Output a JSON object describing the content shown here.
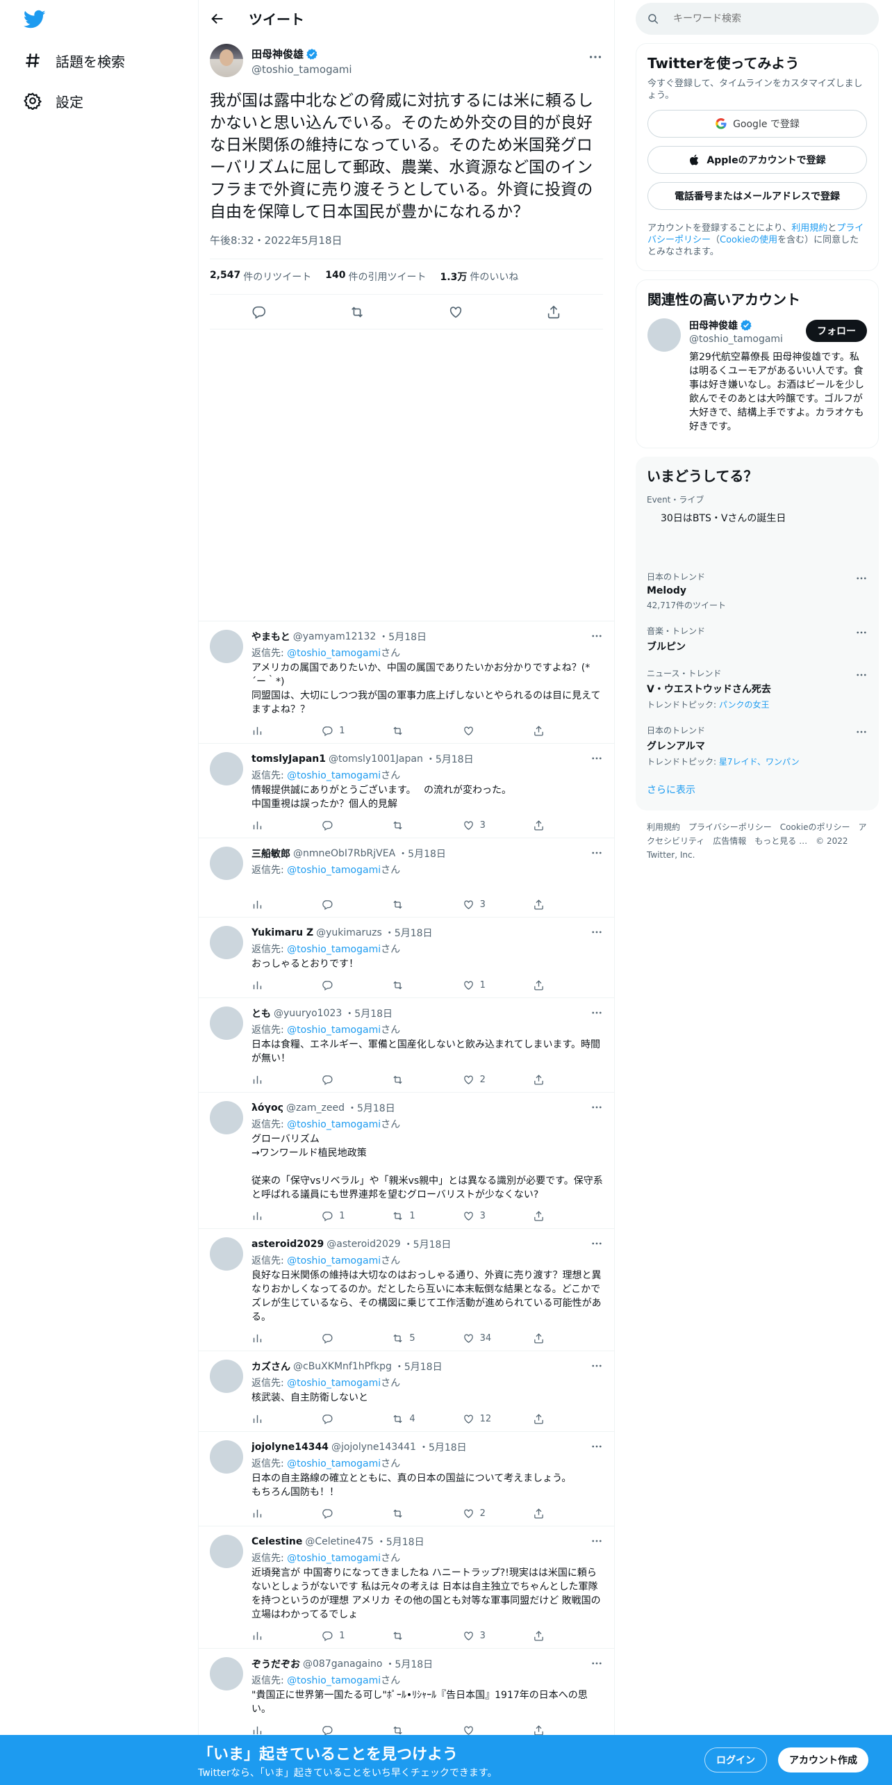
{
  "nav": {
    "explore": "話題を検索",
    "settings": "設定"
  },
  "header": {
    "title": "ツイート"
  },
  "tweet": {
    "author_name": "田母神俊雄",
    "author_handle": "@toshio_tamogami",
    "text": "我が国は露中北などの脅威に対抗するには米に頼るしかないと思い込んでいる。そのため外交の目的が良好な日米関係の維持になっている。そのため米国発グローバリズムに屈して郵政、農業、水資源など国のインフラまで外資に売り渡そうとしている。外資に投資の自由を保障して日本国民が豊かになれるか？",
    "time": "午後8:32・2022年5月18日",
    "retweets": "2,547",
    "retweets_label": "件のリツイート",
    "quotes": "140",
    "quotes_label": "件の引用ツイート",
    "likes": "1.3万",
    "likes_label": "件のいいね"
  },
  "reply_prefix": "返信先: ",
  "reply_suffix": "さん",
  "replies": [
    {
      "name": "やまもと",
      "handle": "@yamyam12132",
      "date": "・5月18日",
      "to": "@toshio_tamogami",
      "text": "アメリカの属国でありたいか、中国の属国でありたいかお分かりですよね？(*´ー｀*)\n同盟国は、大切にしつつ我が国の軍事力底上げしないとやられるのは目に見えてますよね？？",
      "replies": "1",
      "retweets": "",
      "likes": ""
    },
    {
      "name": "tomslyJapan1",
      "handle": "@tomsly1001Japan",
      "date": "・5月18日",
      "to": "@toshio_tamogami",
      "text": "情報提供誠にありがとうございます。　 の流れが変わった。\n中国重視は誤ったか？個人的見解",
      "replies": "",
      "retweets": "",
      "likes": "3"
    },
    {
      "name": "三船敏郎",
      "handle": "@nmneObI7RbRjVEA",
      "date": "・5月18日",
      "to": "@toshio_tamogami",
      "text": "",
      "replies": "",
      "retweets": "",
      "likes": "3"
    },
    {
      "name": "Yukimaru Z",
      "handle": "@yukimaruzs",
      "date": "・5月18日",
      "to": "@toshio_tamogami",
      "text": "おっしゃるとおりです！",
      "replies": "",
      "retweets": "",
      "likes": "1"
    },
    {
      "name": "とも",
      "handle": "@yuuryo1023",
      "date": "・5月18日",
      "to": "@toshio_tamogami",
      "text": "日本は食糧、エネルギー、軍備と国産化しないと飲み込まれてしまいます。時間が無い！",
      "replies": "",
      "retweets": "",
      "likes": "2"
    },
    {
      "name": "λόγος",
      "handle": "@zam_zeed",
      "date": "・5月18日",
      "to": "@toshio_tamogami",
      "text": "グローバリズム\n→ワンワールド植民地政策\n\n従来の「保守vsリベラル」や「親米vs親中」とは異なる識別が必要です。保守系と呼ばれる議員にも世界連邦を望むグローバリストが少なくない?",
      "replies": "1",
      "retweets": "1",
      "likes": "3"
    },
    {
      "name": "asteroid2029",
      "handle": "@asteroid2029",
      "date": "・5月18日",
      "to": "@toshio_tamogami",
      "text": "良好な日米関係の維持は大切なのはおっしゃる通り、外資に売り渡す？理想と異なりおかしくなってるのか。だとしたら互いに本末転倒な結果となる。どこかでズレが生じているなら、その構図に乗じて工作活動が進められている可能性がある。",
      "replies": "",
      "retweets": "5",
      "likes": "34"
    },
    {
      "name": "カズさん",
      "handle": "@cBuXKMnf1hPfkpg",
      "date": "・5月18日",
      "to": "@toshio_tamogami",
      "text": "核武装、自主防衛しないと",
      "replies": "",
      "retweets": "4",
      "likes": "12"
    },
    {
      "name": "jojolyne14344",
      "handle": "@jojolyne143441",
      "date": "・5月18日",
      "to": "@toshio_tamogami",
      "text": "日本の自主路線の確立とともに、真の日本の国益について考えましょう。\nもちろん国防も！！",
      "replies": "",
      "retweets": "",
      "likes": "2"
    },
    {
      "name": "Celestine",
      "handle": "@Celetine475",
      "date": "・5月18日",
      "to": "@toshio_tamogami",
      "text": "近頃発言が 中国寄りになってきましたね ハニートラップ?!現実はは米国に頼らないとしょうがないです 私は元々の考えは 日本は自主独立でちゃんとした軍隊を持つというのが理想 アメリカ その他の国とも対等な軍事同盟だけど 敗戦国の立場はわかってるでしょ",
      "replies": "1",
      "retweets": "",
      "likes": "3"
    },
    {
      "name": "ぞうだぞお",
      "handle": "@087ganagaino",
      "date": "・5月18日",
      "to": "@toshio_tamogami",
      "text": "\"貴国正に世界第一国たる可し\"ﾎﾟｰﾙ•ﾘｼｬｰﾙ『告日本国』1917年の日本への思い。",
      "replies": "",
      "retweets": "",
      "likes": ""
    }
  ],
  "search": {
    "placeholder": "キーワード検索"
  },
  "signup_card": {
    "title": "Twitterを使ってみよう",
    "subtitle": "今すぐ登録して、タイムラインをカスタマイズしましょう。",
    "google": "Google で登録",
    "apple": "Appleのアカウントで登録",
    "phone": "電話番号またはメールアドレスで登録",
    "legal_1": "アカウントを登録することにより、",
    "legal_terms": "利用規約",
    "legal_2": "と",
    "legal_privacy": "プライバシーポリシー",
    "legal_3": "（",
    "legal_cookie": "Cookieの使用",
    "legal_4": "を含む）に同意したとみなされます。"
  },
  "related_card": {
    "title": "関連性の高いアカウント",
    "name": "田母神俊雄",
    "handle": "@toshio_tamogami",
    "bio": "第29代航空幕僚長 田母神俊雄です。私は明るくユーモアがあるいい人です。食事は好き嫌いなし。お酒はビールを少し飲んでそのあとは大吟醸です。ゴルフが大好きで、結構上手ですよ。カラオケも好きです。",
    "follow": "フォロー"
  },
  "trends_card": {
    "title": "いまどうしてる？",
    "items": [
      {
        "meta": "Event・ライブ",
        "name": "30日はBTS・Vさんの誕生日",
        "count": "",
        "topic_label": "",
        "topics": ""
      },
      {
        "meta": "日本のトレンド",
        "name": "Melody",
        "count": "42,717件のツイート",
        "topic_label": "",
        "topics": ""
      },
      {
        "meta": "音楽・トレンド",
        "name": "ブルピン",
        "count": "",
        "topic_label": "",
        "topics": ""
      },
      {
        "meta": "ニュース・トレンド",
        "name": "V・ウエストウッドさん死去",
        "count": "",
        "topic_label": "トレンドトピック: ",
        "topics": "パンクの女王"
      },
      {
        "meta": "日本のトレンド",
        "name": "グレンアルマ",
        "count": "",
        "topic_label": "トレンドトピック: ",
        "topics": "星7レイド、ワンパン"
      }
    ],
    "show_more": "さらに表示"
  },
  "footer": {
    "links": [
      "利用規約",
      "プライバシーポリシー",
      "Cookieのポリシー",
      "アクセシビリティ",
      "広告情報",
      "もっと見る …",
      "© 2022 Twitter, Inc."
    ]
  },
  "bottom_bar": {
    "title": "「いま」起きていることを見つけよう",
    "subtitle": "Twitterなら、「いま」起きていることをいち早くチェックできます。",
    "login": "ログイン",
    "signup": "アカウント作成"
  },
  "colors": {
    "brand": "#1d9bf0",
    "text": "#0f1419",
    "muted": "#536471"
  }
}
